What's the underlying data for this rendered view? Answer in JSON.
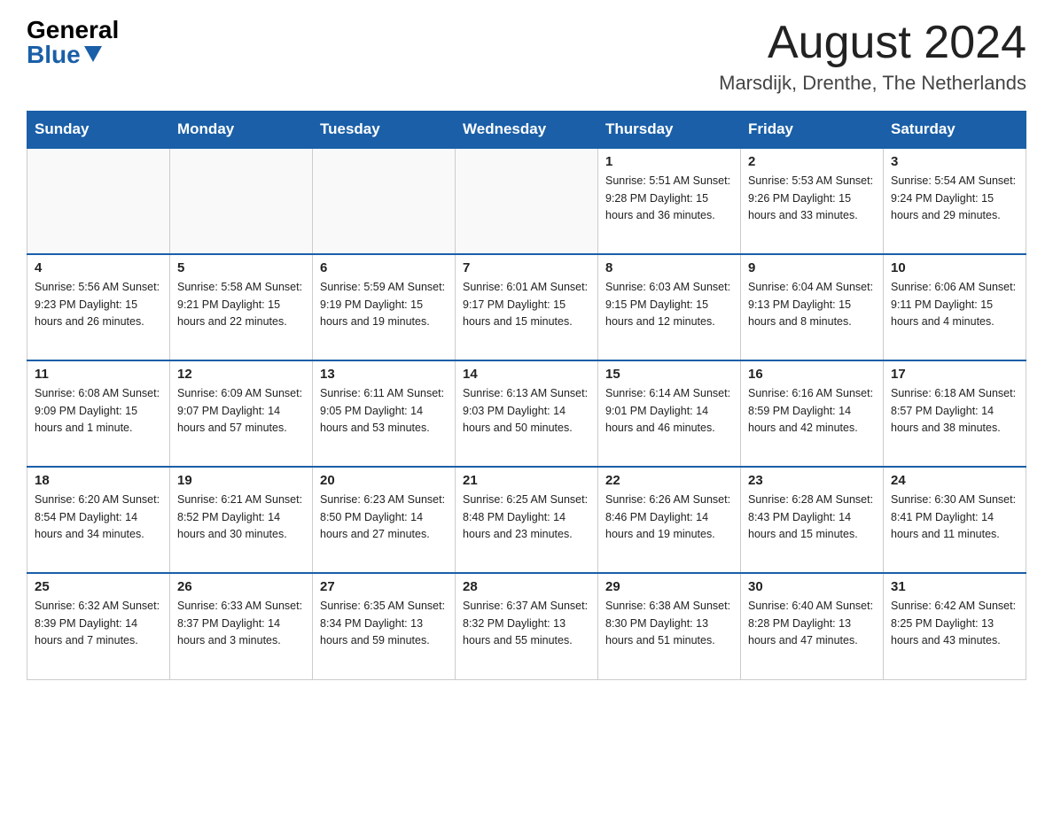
{
  "header": {
    "logo_general": "General",
    "logo_blue": "Blue",
    "month_title": "August 2024",
    "location": "Marsdijk, Drenthe, The Netherlands"
  },
  "days_of_week": [
    "Sunday",
    "Monday",
    "Tuesday",
    "Wednesday",
    "Thursday",
    "Friday",
    "Saturday"
  ],
  "weeks": [
    [
      {
        "day": "",
        "info": ""
      },
      {
        "day": "",
        "info": ""
      },
      {
        "day": "",
        "info": ""
      },
      {
        "day": "",
        "info": ""
      },
      {
        "day": "1",
        "info": "Sunrise: 5:51 AM\nSunset: 9:28 PM\nDaylight: 15 hours and 36 minutes."
      },
      {
        "day": "2",
        "info": "Sunrise: 5:53 AM\nSunset: 9:26 PM\nDaylight: 15 hours and 33 minutes."
      },
      {
        "day": "3",
        "info": "Sunrise: 5:54 AM\nSunset: 9:24 PM\nDaylight: 15 hours and 29 minutes."
      }
    ],
    [
      {
        "day": "4",
        "info": "Sunrise: 5:56 AM\nSunset: 9:23 PM\nDaylight: 15 hours and 26 minutes."
      },
      {
        "day": "5",
        "info": "Sunrise: 5:58 AM\nSunset: 9:21 PM\nDaylight: 15 hours and 22 minutes."
      },
      {
        "day": "6",
        "info": "Sunrise: 5:59 AM\nSunset: 9:19 PM\nDaylight: 15 hours and 19 minutes."
      },
      {
        "day": "7",
        "info": "Sunrise: 6:01 AM\nSunset: 9:17 PM\nDaylight: 15 hours and 15 minutes."
      },
      {
        "day": "8",
        "info": "Sunrise: 6:03 AM\nSunset: 9:15 PM\nDaylight: 15 hours and 12 minutes."
      },
      {
        "day": "9",
        "info": "Sunrise: 6:04 AM\nSunset: 9:13 PM\nDaylight: 15 hours and 8 minutes."
      },
      {
        "day": "10",
        "info": "Sunrise: 6:06 AM\nSunset: 9:11 PM\nDaylight: 15 hours and 4 minutes."
      }
    ],
    [
      {
        "day": "11",
        "info": "Sunrise: 6:08 AM\nSunset: 9:09 PM\nDaylight: 15 hours and 1 minute."
      },
      {
        "day": "12",
        "info": "Sunrise: 6:09 AM\nSunset: 9:07 PM\nDaylight: 14 hours and 57 minutes."
      },
      {
        "day": "13",
        "info": "Sunrise: 6:11 AM\nSunset: 9:05 PM\nDaylight: 14 hours and 53 minutes."
      },
      {
        "day": "14",
        "info": "Sunrise: 6:13 AM\nSunset: 9:03 PM\nDaylight: 14 hours and 50 minutes."
      },
      {
        "day": "15",
        "info": "Sunrise: 6:14 AM\nSunset: 9:01 PM\nDaylight: 14 hours and 46 minutes."
      },
      {
        "day": "16",
        "info": "Sunrise: 6:16 AM\nSunset: 8:59 PM\nDaylight: 14 hours and 42 minutes."
      },
      {
        "day": "17",
        "info": "Sunrise: 6:18 AM\nSunset: 8:57 PM\nDaylight: 14 hours and 38 minutes."
      }
    ],
    [
      {
        "day": "18",
        "info": "Sunrise: 6:20 AM\nSunset: 8:54 PM\nDaylight: 14 hours and 34 minutes."
      },
      {
        "day": "19",
        "info": "Sunrise: 6:21 AM\nSunset: 8:52 PM\nDaylight: 14 hours and 30 minutes."
      },
      {
        "day": "20",
        "info": "Sunrise: 6:23 AM\nSunset: 8:50 PM\nDaylight: 14 hours and 27 minutes."
      },
      {
        "day": "21",
        "info": "Sunrise: 6:25 AM\nSunset: 8:48 PM\nDaylight: 14 hours and 23 minutes."
      },
      {
        "day": "22",
        "info": "Sunrise: 6:26 AM\nSunset: 8:46 PM\nDaylight: 14 hours and 19 minutes."
      },
      {
        "day": "23",
        "info": "Sunrise: 6:28 AM\nSunset: 8:43 PM\nDaylight: 14 hours and 15 minutes."
      },
      {
        "day": "24",
        "info": "Sunrise: 6:30 AM\nSunset: 8:41 PM\nDaylight: 14 hours and 11 minutes."
      }
    ],
    [
      {
        "day": "25",
        "info": "Sunrise: 6:32 AM\nSunset: 8:39 PM\nDaylight: 14 hours and 7 minutes."
      },
      {
        "day": "26",
        "info": "Sunrise: 6:33 AM\nSunset: 8:37 PM\nDaylight: 14 hours and 3 minutes."
      },
      {
        "day": "27",
        "info": "Sunrise: 6:35 AM\nSunset: 8:34 PM\nDaylight: 13 hours and 59 minutes."
      },
      {
        "day": "28",
        "info": "Sunrise: 6:37 AM\nSunset: 8:32 PM\nDaylight: 13 hours and 55 minutes."
      },
      {
        "day": "29",
        "info": "Sunrise: 6:38 AM\nSunset: 8:30 PM\nDaylight: 13 hours and 51 minutes."
      },
      {
        "day": "30",
        "info": "Sunrise: 6:40 AM\nSunset: 8:28 PM\nDaylight: 13 hours and 47 minutes."
      },
      {
        "day": "31",
        "info": "Sunrise: 6:42 AM\nSunset: 8:25 PM\nDaylight: 13 hours and 43 minutes."
      }
    ]
  ]
}
